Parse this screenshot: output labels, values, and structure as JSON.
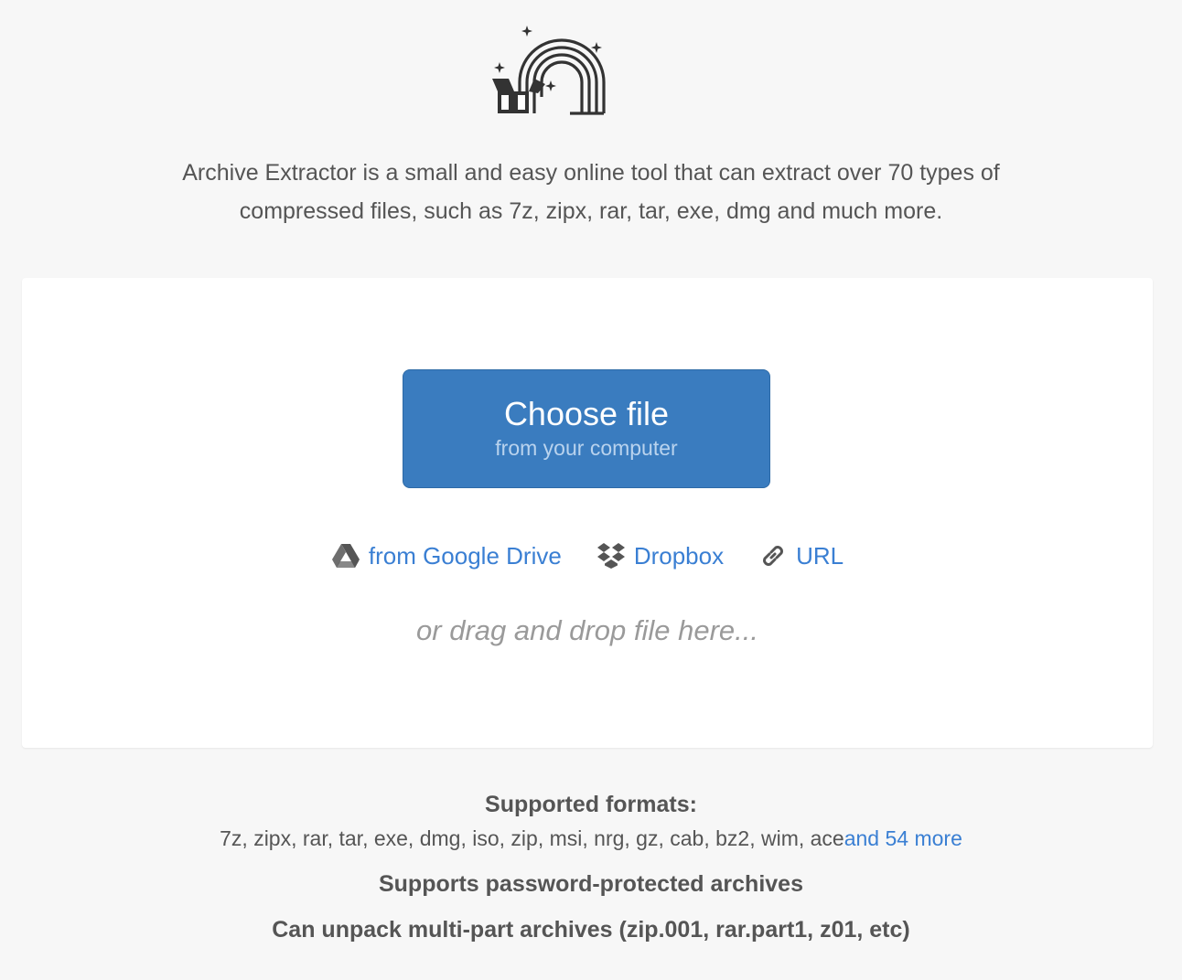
{
  "logo": {
    "icon": "rainbow-box-icon"
  },
  "intro": {
    "line1": "Archive Extractor is a small and easy online tool that can extract over 70 types of",
    "line2": "compressed files, such as 7z, zipx, rar, tar, exe, dmg and much more."
  },
  "upload": {
    "choose_title": "Choose file",
    "choose_subtitle": "from your computer",
    "sources": [
      {
        "label": "from Google Drive",
        "icon": "google-drive-icon"
      },
      {
        "label": "Dropbox",
        "icon": "dropbox-icon"
      },
      {
        "label": "URL",
        "icon": "link-icon"
      }
    ],
    "drag_text": "or drag and drop file here..."
  },
  "footer": {
    "formats_heading": "Supported formats:",
    "formats_list": "7z, zipx, rar, tar, exe, dmg, iso, zip, msi, nrg, gz, cab, bz2, wim, ace",
    "formats_more": "and 54 more",
    "feature_password": "Supports password-protected archives",
    "feature_multipart": "Can unpack multi-part archives (zip.001, rar.part1, z01, etc)"
  },
  "colors": {
    "background": "#f7f7f7",
    "button": "#3a7cbf",
    "link": "#3a7fd3",
    "text": "#555555"
  }
}
